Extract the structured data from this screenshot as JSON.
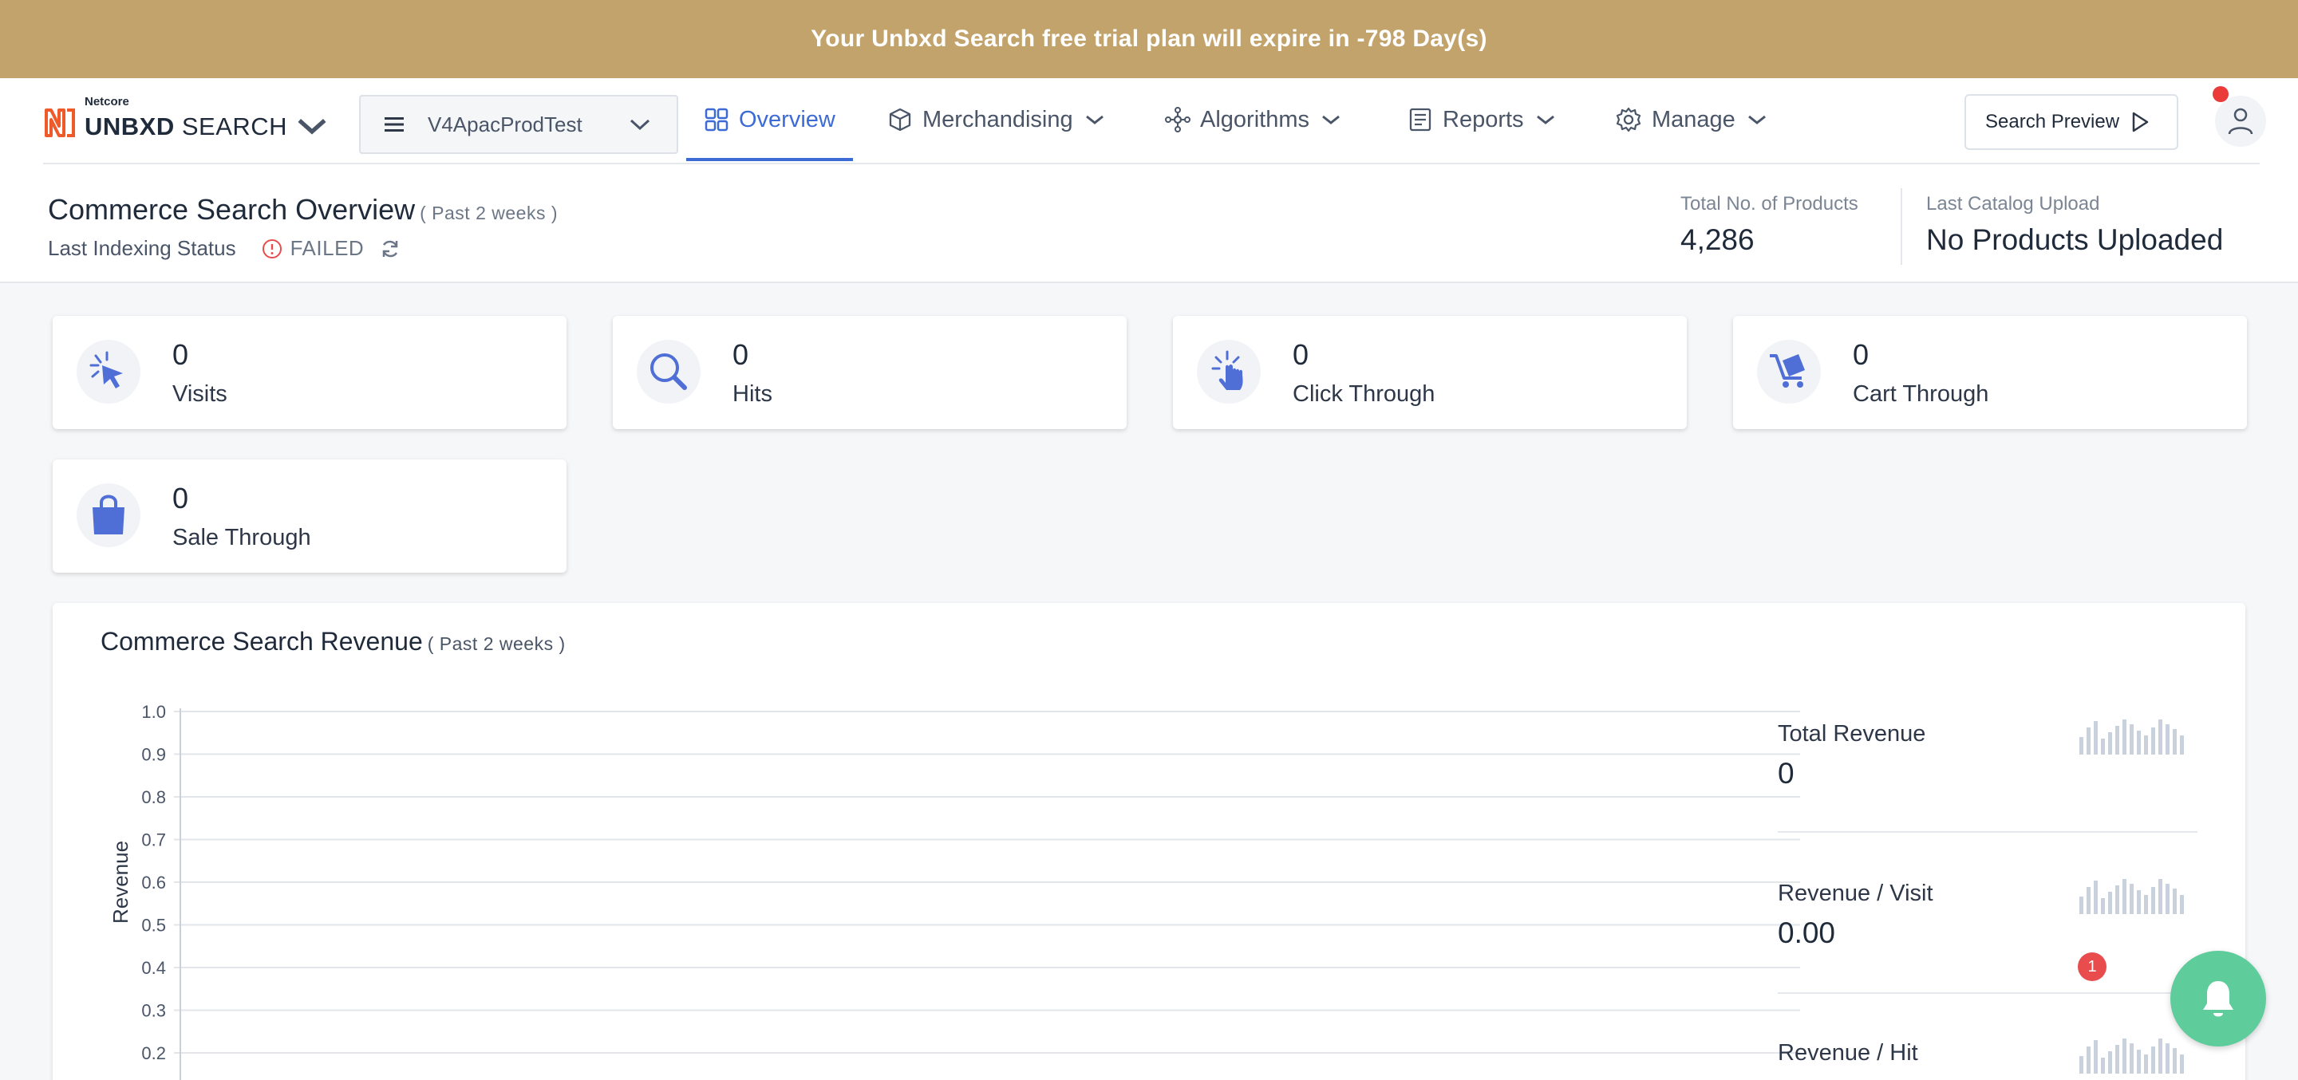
{
  "banner": {
    "text": "Your Unbxd Search free trial plan will expire in -798 Day(s)"
  },
  "brand": {
    "small": "Netcore",
    "bold": "UNBXD",
    "word": "SEARCH"
  },
  "site_selector": {
    "value": "V4ApacProdTest"
  },
  "nav": {
    "tabs": [
      {
        "label": "Overview",
        "icon": "grid-icon",
        "active": true
      },
      {
        "label": "Merchandising",
        "icon": "cube-icon"
      },
      {
        "label": "Algorithms",
        "icon": "nodes-icon"
      },
      {
        "label": "Reports",
        "icon": "report-icon"
      },
      {
        "label": "Manage",
        "icon": "gear-icon"
      }
    ],
    "preview_button": "Search Preview"
  },
  "overview": {
    "title": "Commerce Search Overview",
    "period": "( Past 2 weeks )",
    "indexing_label": "Last Indexing Status",
    "indexing_status": "FAILED",
    "total_products_label": "Total No. of Products",
    "total_products_value": "4,286",
    "catalog_label": "Last Catalog Upload",
    "catalog_value": "No Products Uploaded"
  },
  "cards": [
    {
      "value": "0",
      "label": "Visits",
      "icon": "cursor-click-icon"
    },
    {
      "value": "0",
      "label": "Hits",
      "icon": "magnifier-icon"
    },
    {
      "value": "0",
      "label": "Click Through",
      "icon": "hand-pointer-icon"
    },
    {
      "value": "0",
      "label": "Cart Through",
      "icon": "cart-icon"
    },
    {
      "value": "0",
      "label": "Sale Through",
      "icon": "shopping-bag-icon"
    }
  ],
  "revenue": {
    "title": "Commerce Search Revenue",
    "period": "( Past 2 weeks )",
    "metrics": [
      {
        "label": "Total Revenue",
        "value": "0"
      },
      {
        "label": "Revenue / Visit",
        "value": "0.00"
      },
      {
        "label": "Revenue / Hit",
        "value": ""
      }
    ]
  },
  "chart_data": {
    "type": "line",
    "title": "",
    "xlabel": "",
    "ylabel": "Revenue",
    "yticks": [
      "1.0",
      "0.9",
      "0.8",
      "0.7",
      "0.6",
      "0.5",
      "0.4",
      "0.3",
      "0.2"
    ],
    "ylim": [
      0,
      1.0
    ],
    "series": [],
    "grid": true
  },
  "notifications": {
    "badge_count": "1"
  },
  "colors": {
    "banner": "#c2a36b",
    "accent": "#3d6bd6",
    "fab": "#5fcc9c",
    "alert": "#e84c4c"
  }
}
